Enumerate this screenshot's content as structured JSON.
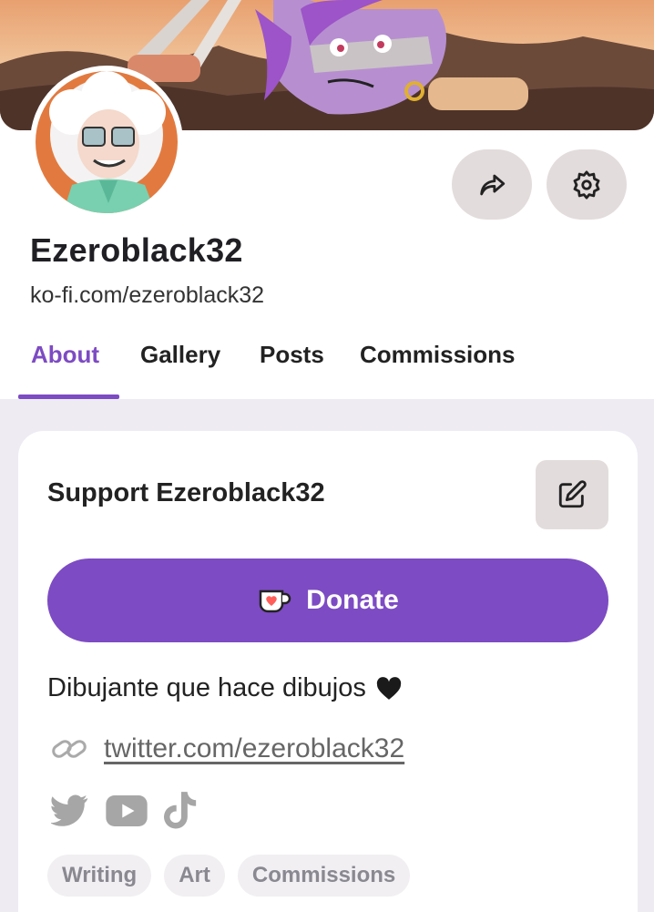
{
  "profile": {
    "username": "Ezeroblack32",
    "url": "ko-fi.com/ezeroblack32"
  },
  "actions": {
    "share_icon": "share-arrow-icon",
    "settings_icon": "gear-icon"
  },
  "tabs": [
    {
      "label": "About",
      "active": true
    },
    {
      "label": "Gallery",
      "active": false
    },
    {
      "label": "Posts",
      "active": false
    },
    {
      "label": "Commissions",
      "active": false
    }
  ],
  "support": {
    "title": "Support Ezeroblack32",
    "edit_icon": "edit-icon",
    "donate_label": "Donate",
    "donate_icon": "ko-fi-cup-icon",
    "bio": "Dibujante que hace dibujos",
    "bio_icon": "heart-icon",
    "link_text": "twitter.com/ezeroblack32",
    "socials": [
      "twitter-icon",
      "youtube-icon",
      "tiktok-icon"
    ],
    "tags": [
      "Writing",
      "Art",
      "Commissions"
    ]
  },
  "colors": {
    "accent": "#7d4bc3",
    "button_gray": "#e3dcdc",
    "content_bg": "#eeebf3"
  }
}
